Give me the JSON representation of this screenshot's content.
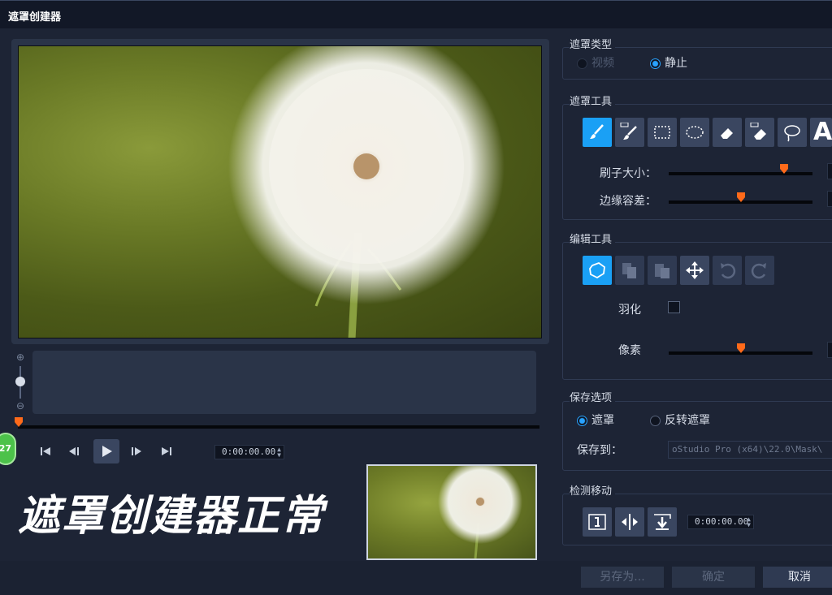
{
  "window": {
    "title": "遮罩创建器"
  },
  "preview": {
    "caption": "遮罩创建器正常",
    "timecode": "0:00:00.00",
    "badge": "27"
  },
  "transport": {
    "icons": [
      "skip-start-icon",
      "step-back-icon",
      "play-icon",
      "step-forward-icon",
      "skip-end-icon"
    ]
  },
  "mask_type": {
    "title": "遮罩类型",
    "video_label": "视频",
    "still_label": "静止",
    "selected": "still"
  },
  "mask_tools": {
    "title": "遮罩工具",
    "brush_size_label": "刷子大小：",
    "edge_tolerance_label": "边缘容差：",
    "brush_size_value": 0.8,
    "edge_tolerance_value": 0.5,
    "icons": [
      "brush-icon",
      "smart-brush-icon",
      "rect-select-icon",
      "ellipse-select-icon",
      "eraser-icon",
      "smart-eraser-icon",
      "lasso-icon",
      "text-tool-icon"
    ],
    "text_tool_glyph": "A"
  },
  "edit_tools": {
    "title": "编辑工具",
    "feather_label": "羽化",
    "pixel_label": "像素",
    "pixel_value": 0.5,
    "icons": [
      "auto-outline-icon",
      "copy-icon",
      "paste-icon",
      "move-icon",
      "undo-icon",
      "redo-icon"
    ]
  },
  "save_options": {
    "title": "保存选项",
    "mask_label": "遮罩",
    "invert_label": "反转遮罩",
    "selected": "mask",
    "save_to_label": "保存到：",
    "save_path": "oStudio Pro (x64)\\22.0\\Mask\\"
  },
  "detect_motion": {
    "title": "检测移动",
    "timecode": "0:00:00.00"
  },
  "buttons": {
    "save_as": "另存为...",
    "ok": "确定",
    "cancel": "取消"
  },
  "colors": {
    "accent": "#1aa0f5",
    "slider_knob": "#ff6a1a",
    "background": "#1d2435"
  }
}
